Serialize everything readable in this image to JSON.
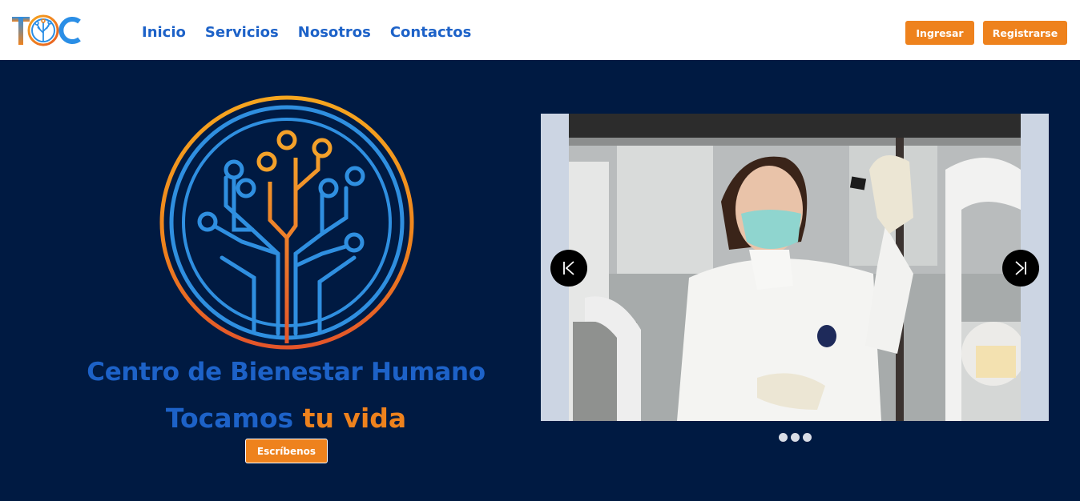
{
  "header": {
    "logo_text": "TOC",
    "nav": [
      {
        "label": "Inicio"
      },
      {
        "label": "Servicios"
      },
      {
        "label": "Nosotros"
      },
      {
        "label": "Contactos"
      }
    ],
    "login_label": "Ingresar",
    "register_label": "Registrarse"
  },
  "hero": {
    "title": "Centro de Bienestar Humano",
    "slogan_part1": "Tocamos",
    "slogan_part2": "tu vida",
    "cta_label": "Escríbenos"
  },
  "carousel": {
    "slide_icon": "scientist-photo",
    "prev_icon": "skip-previous-icon",
    "next_icon": "skip-next-icon",
    "slide_count": 3,
    "active_index": 0
  },
  "colors": {
    "brand_blue": "#1d62c8",
    "brand_orange": "#ee821d",
    "hero_bg": "#001a42",
    "carousel_bg": "#ccd5e3"
  }
}
